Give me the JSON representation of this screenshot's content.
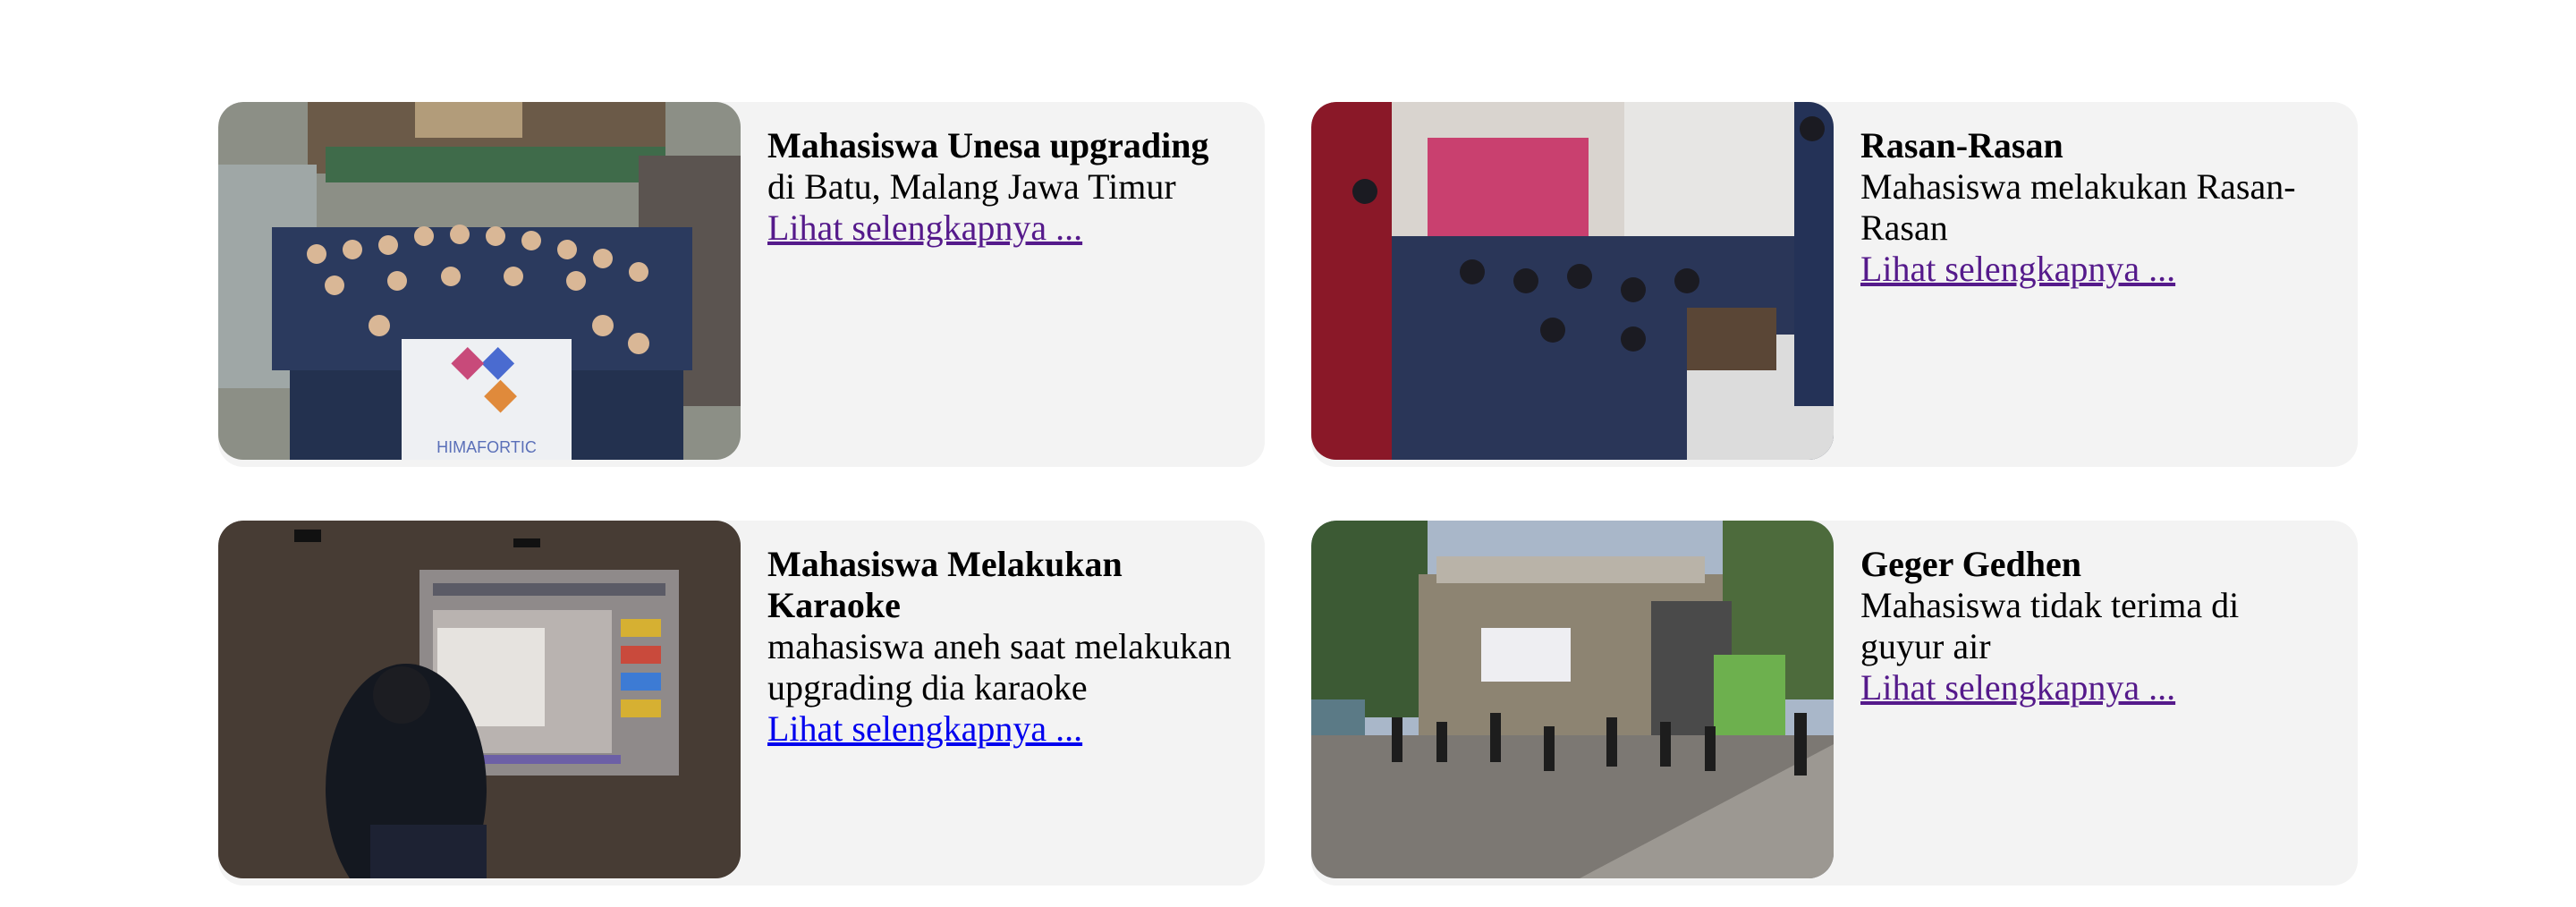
{
  "cards": [
    {
      "title": "Mahasiswa Unesa upgrading",
      "description": "di Batu, Malang Jawa Timur",
      "link": "Lihat selengkapnya ...",
      "banner_text": "HIMAFORTIC"
    },
    {
      "title": "Rasan-Rasan",
      "description": "Mahasiswa melakukan Rasan-Rasan",
      "link": "Lihat selengkapnya ..."
    },
    {
      "title": "Mahasiswa Melakukan Karaoke",
      "description": "mahasiswa aneh saat melakukan upgrading dia karaoke",
      "link": "Lihat selengkapnya ..."
    },
    {
      "title": "Geger Gedhen",
      "description": "Mahasiswa tidak terima di guyur air",
      "link": "Lihat selengkapnya ..."
    }
  ],
  "colors": {
    "card_bg": "#f3f3f3",
    "link_visited": "#551a8b",
    "link_unvisited": "#0000ee"
  }
}
